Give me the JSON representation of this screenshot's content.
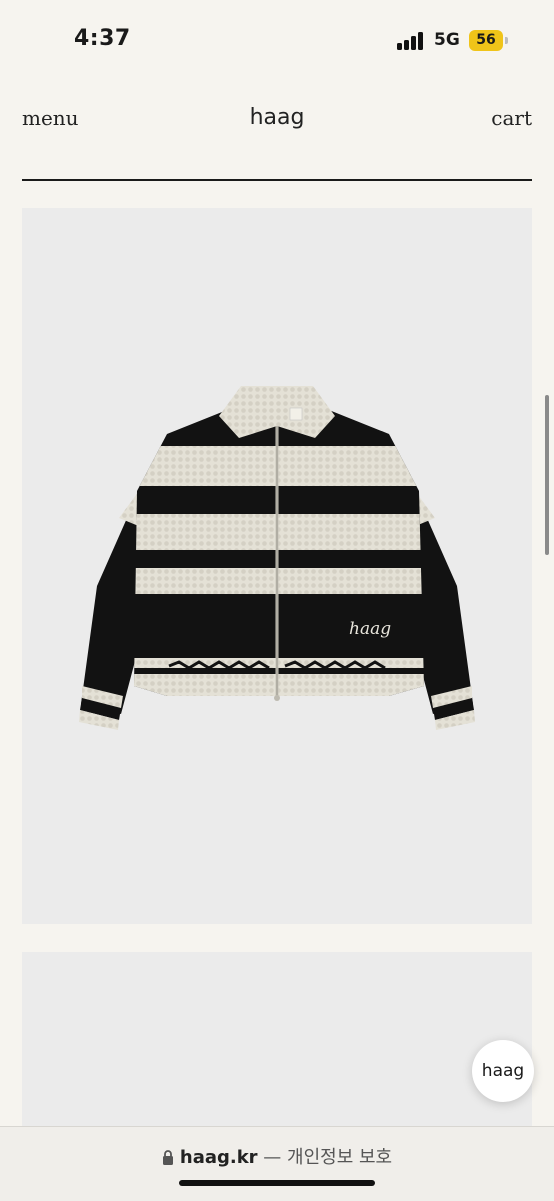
{
  "status_bar": {
    "time": "4:37",
    "network": "5G",
    "battery": "56",
    "battery_color": "#f0c419"
  },
  "header": {
    "menu_label": "menu",
    "brand": "haag",
    "cart_label": "cart"
  },
  "product": {
    "image_icon": "knit-zip-cardigan-image",
    "embroidery_text": "haag"
  },
  "chat_bubble": {
    "label": "haag"
  },
  "url_bar": {
    "icon": "lock-icon",
    "domain": "haag.kr",
    "separator": "—",
    "privacy_label": "개인정보 보호"
  },
  "colors": {
    "page_background": "#f6f4ef",
    "image_background": "#ebebeb",
    "knit_cream": "#e4e1d6",
    "knit_black": "#121212"
  }
}
